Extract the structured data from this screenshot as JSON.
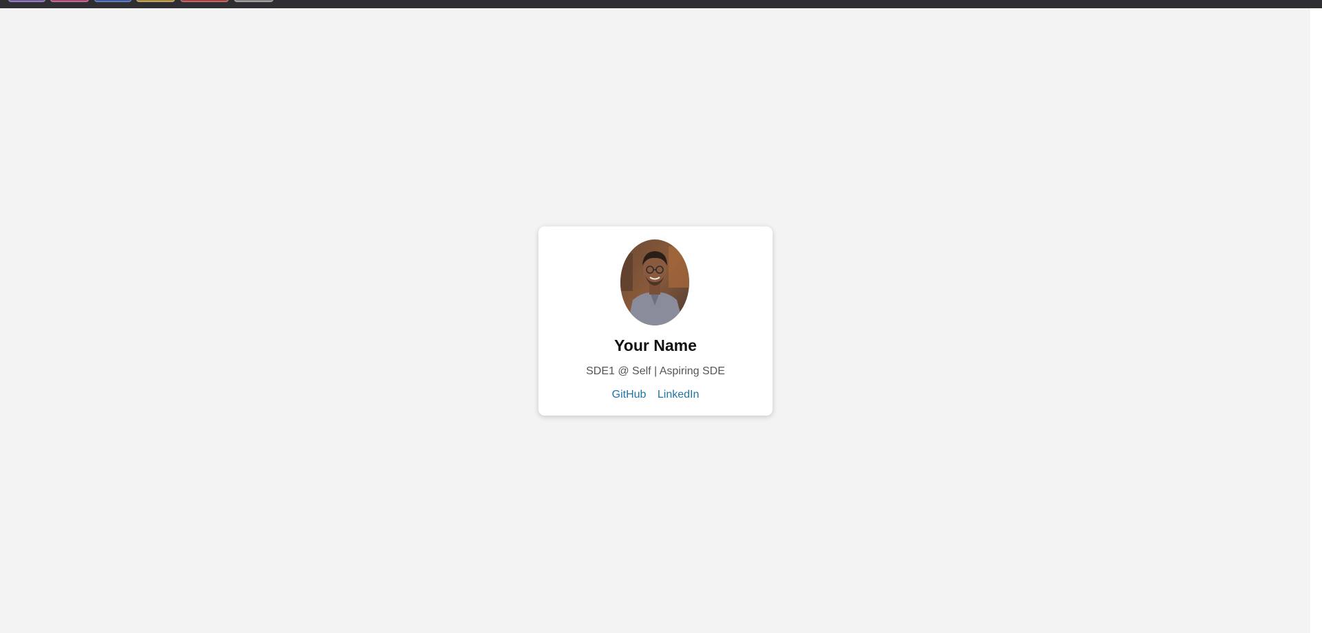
{
  "profile": {
    "name": "Your Name",
    "role": "SDE1 @ Self | Aspiring SDE",
    "avatar_icon": "profile-photo"
  },
  "links": [
    {
      "label": "GitHub"
    },
    {
      "label": "LinkedIn"
    }
  ],
  "colors": {
    "background": "#f3f3f3",
    "card": "#ffffff",
    "link": "#1f74a6",
    "topbar": "#2f2f33"
  },
  "topbar": {
    "tab_colors": [
      "#7b5ea8",
      "#b04b7a",
      "#3f5fa8",
      "#b08f3c",
      "#b04444",
      "#8a8a8a"
    ],
    "more_glyph": "⠿"
  }
}
